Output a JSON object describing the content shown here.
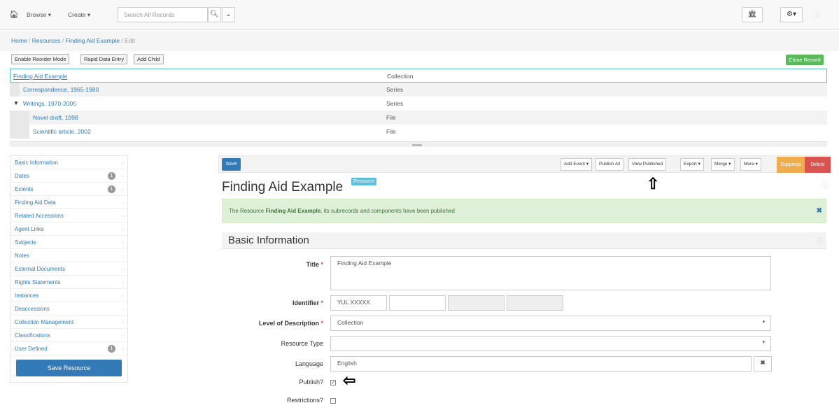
{
  "topbar": {
    "browse": "Browse",
    "create": "Create",
    "search_placeholder": "Search All Records"
  },
  "breadcrumb": {
    "home": "Home",
    "resources": "Resources",
    "record": "Finding Aid Example",
    "edit": "Edit"
  },
  "toolbar": {
    "reorder": "Enable Reorder Mode",
    "rapid": "Rapid Data Entry",
    "add_child": "Add Child",
    "close": "Close Record"
  },
  "tree": [
    {
      "title": "Finding Aid Example",
      "level": "Collection"
    },
    {
      "title": "Correspondence, 1965-1980",
      "level": "Series"
    },
    {
      "title": "Writings, 1970-2005",
      "level": "Series"
    },
    {
      "title": "Novel draft, 1998",
      "level": "File"
    },
    {
      "title": "Scientific article, 2002",
      "level": "File"
    }
  ],
  "sidebar": {
    "items": [
      {
        "label": "Basic Information",
        "badge": ""
      },
      {
        "label": "Dates",
        "badge": "1"
      },
      {
        "label": "Extents",
        "badge": "1"
      },
      {
        "label": "Finding Aid Data",
        "badge": ""
      },
      {
        "label": "Related Accessions",
        "badge": ""
      },
      {
        "label": "Agent Links",
        "badge": ""
      },
      {
        "label": "Subjects",
        "badge": ""
      },
      {
        "label": "Notes",
        "badge": ""
      },
      {
        "label": "External Documents",
        "badge": ""
      },
      {
        "label": "Rights Statements",
        "badge": ""
      },
      {
        "label": "Instances",
        "badge": ""
      },
      {
        "label": "Deaccessions",
        "badge": ""
      },
      {
        "label": "Collection Management",
        "badge": ""
      },
      {
        "label": "Classifications",
        "badge": ""
      },
      {
        "label": "User Defined",
        "badge": "1"
      }
    ],
    "save": "Save Resource"
  },
  "actions": {
    "save": "Save",
    "add_event": "Add Event",
    "publish_all": "Publish All",
    "view_published": "View Published",
    "export": "Export",
    "merge": "Merge",
    "more": "More",
    "suppress": "Suppress",
    "delete": "Delete"
  },
  "record": {
    "title": "Finding Aid Example",
    "type_badge": "Resource",
    "alert_prefix": "The Resource ",
    "alert_name": "Finding Aid Example",
    "alert_suffix": ", its subrecords and components have been published",
    "section": "Basic Information"
  },
  "form": {
    "title_label": "Title",
    "title_value": "Finding Aid Example",
    "identifier_label": "Identifier",
    "identifier_value": "YUL XXXXX",
    "level_label": "Level of Description",
    "level_value": "Collection",
    "resource_type_label": "Resource Type",
    "resource_type_value": "",
    "language_label": "Language",
    "language_value": "English",
    "publish_label": "Publish?",
    "publish_checked": true,
    "restrictions_label": "Restrictions?",
    "restrictions_checked": false
  }
}
